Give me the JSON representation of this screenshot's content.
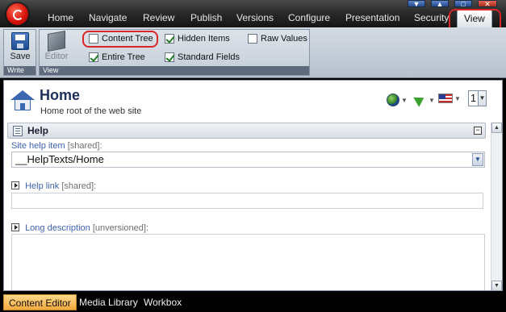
{
  "menubar": {
    "tabs": [
      {
        "label": "Home",
        "active": false
      },
      {
        "label": "Navigate",
        "active": false
      },
      {
        "label": "Review",
        "active": false
      },
      {
        "label": "Publish",
        "active": false
      },
      {
        "label": "Versions",
        "active": false
      },
      {
        "label": "Configure",
        "active": false
      },
      {
        "label": "Presentation",
        "active": false
      },
      {
        "label": "Security",
        "active": false
      },
      {
        "label": "View",
        "active": true
      }
    ],
    "window_controls": {
      "minimize": "▼",
      "restore": "▲",
      "maximize": "□",
      "close": "✕"
    }
  },
  "ribbon": {
    "write_group": {
      "caption": "Write",
      "save_label": "Save"
    },
    "view_group": {
      "caption": "View",
      "editor_label": "Editor"
    },
    "checkboxes": {
      "content_tree": {
        "label": "Content Tree",
        "checked": false
      },
      "hidden_items": {
        "label": "Hidden Items",
        "checked": true
      },
      "raw_values": {
        "label": "Raw Values",
        "checked": false
      },
      "entire_tree": {
        "label": "Entire Tree",
        "checked": true
      },
      "standard_fields": {
        "label": "Standard Fields",
        "checked": true
      }
    }
  },
  "editor": {
    "title": "Home",
    "subtitle": "Home root of the web site",
    "version": "1",
    "section": {
      "title": "Help",
      "collapse_symbol": "−"
    },
    "fields": {
      "site_help_item": {
        "label": "Site help item",
        "tag": "[shared]:",
        "value": "__HelpTexts/Home"
      },
      "help_link": {
        "label": "Help link",
        "tag": "[shared]:",
        "value": ""
      },
      "long_description": {
        "label": "Long description",
        "tag": "[unversioned]:",
        "value": ""
      }
    }
  },
  "bottombar": {
    "tabs": [
      {
        "label": "Content Editor",
        "active": true
      },
      {
        "label": "Media Library",
        "active": false
      },
      {
        "label": "Workbox",
        "active": false
      }
    ]
  },
  "colors": {
    "accent_blue": "#3e63ae",
    "highlight_ring": "#d92626",
    "active_bottom_tab": "#f2a93b"
  }
}
